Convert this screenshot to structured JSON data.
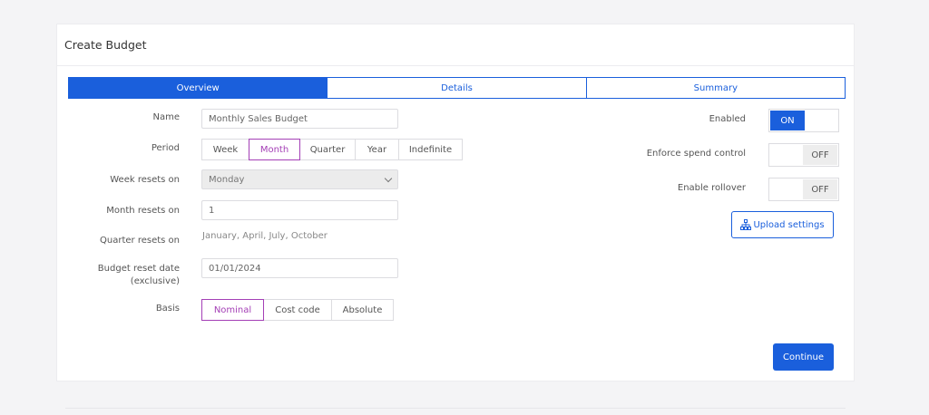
{
  "header": {
    "title": "Create Budget"
  },
  "tabs": [
    {
      "label": "Overview",
      "active": true
    },
    {
      "label": "Details",
      "active": false
    },
    {
      "label": "Summary",
      "active": false
    }
  ],
  "form": {
    "name": {
      "label": "Name",
      "value": "Monthly Sales Budget"
    },
    "period": {
      "label": "Period",
      "options": [
        "Week",
        "Month",
        "Quarter",
        "Year",
        "Indefinite"
      ],
      "selected": "Month"
    },
    "week_resets_on": {
      "label": "Week resets on",
      "value": "Monday"
    },
    "month_resets_on": {
      "label": "Month resets on",
      "value": "1"
    },
    "quarter_resets_on": {
      "label": "Quarter resets on",
      "value": "January, April, July, October"
    },
    "budget_reset_date": {
      "label_line1": "Budget reset date",
      "label_line2": "(exclusive)",
      "value": "01/01/2024"
    },
    "basis": {
      "label": "Basis",
      "options": [
        "Nominal",
        "Cost code",
        "Absolute"
      ],
      "selected": "Nominal"
    }
  },
  "settings": {
    "enabled": {
      "label": "Enabled",
      "state": "ON"
    },
    "enforce_spend_control": {
      "label": "Enforce spend control",
      "state": "OFF"
    },
    "enable_rollover": {
      "label": "Enable rollover",
      "state": "OFF"
    },
    "upload_label": "Upload settings",
    "upload_icon": "sitemap-icon"
  },
  "actions": {
    "continue_label": "Continue"
  },
  "colors": {
    "accent": "#1a5fdc",
    "selected_option": "#a43fb6",
    "page_background": "#f4f4f6"
  }
}
